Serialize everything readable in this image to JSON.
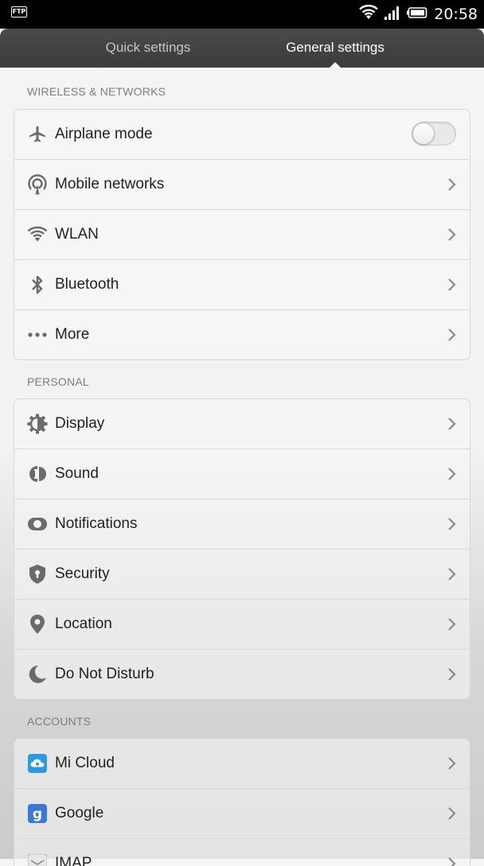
{
  "status_bar": {
    "left_icon_label": "FTP",
    "time": "20:58",
    "icons": [
      "ftp-icon",
      "wifi-icon",
      "signal-icon",
      "battery-icon"
    ]
  },
  "tabs": {
    "quick": "Quick settings",
    "general": "General settings",
    "active": "general"
  },
  "sections": {
    "wireless": {
      "header": "WIRELESS & NETWORKS",
      "items": [
        {
          "label": "Airplane mode",
          "icon": "airplane-icon",
          "control": "toggle",
          "toggle_on": false
        },
        {
          "label": "Mobile networks",
          "icon": "mobile-networks-icon",
          "control": "chevron"
        },
        {
          "label": "WLAN",
          "icon": "wifi-icon",
          "control": "chevron"
        },
        {
          "label": "Bluetooth",
          "icon": "bluetooth-icon",
          "control": "chevron"
        },
        {
          "label": "More",
          "icon": "more-icon",
          "control": "chevron"
        }
      ]
    },
    "personal": {
      "header": "PERSONAL",
      "items": [
        {
          "label": "Display",
          "icon": "display-icon",
          "control": "chevron"
        },
        {
          "label": "Sound",
          "icon": "sound-icon",
          "control": "chevron"
        },
        {
          "label": "Notifications",
          "icon": "notifications-icon",
          "control": "chevron"
        },
        {
          "label": "Security",
          "icon": "security-icon",
          "control": "chevron"
        },
        {
          "label": "Location",
          "icon": "location-icon",
          "control": "chevron"
        },
        {
          "label": "Do Not Disturb",
          "icon": "moon-icon",
          "control": "chevron"
        }
      ]
    },
    "accounts": {
      "header": "ACCOUNTS",
      "items": [
        {
          "label": "Mi Cloud",
          "icon": "mi-cloud-icon",
          "control": "chevron"
        },
        {
          "label": "Google",
          "icon": "google-icon",
          "control": "chevron"
        },
        {
          "label": "IMAP",
          "icon": "mail-icon",
          "control": "chevron"
        }
      ]
    }
  },
  "colors": {
    "status_bar_bg": "#000000",
    "tab_bar_bg": "#424242",
    "icon_gray": "#6b6b6b",
    "mi_cloud_blue": "#2a9be0",
    "google_blue": "#3a78d8"
  }
}
